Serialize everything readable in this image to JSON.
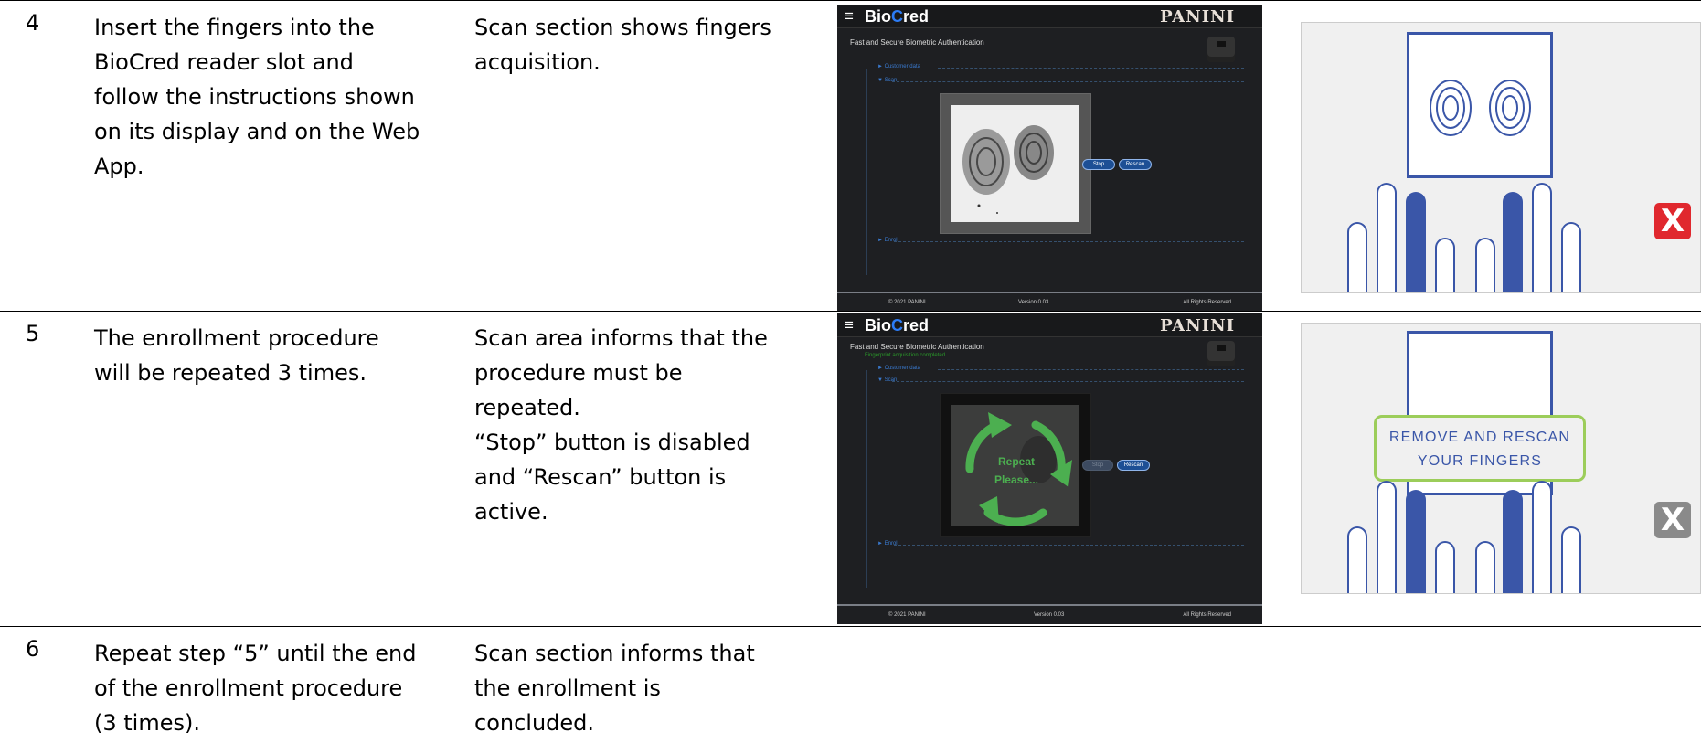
{
  "rows": [
    {
      "number": "4",
      "step_lines": [
        "Insert the fingers into the",
        "BioCred reader slot and",
        "follow the instructions shown",
        "on its display and on the Web",
        "App."
      ],
      "result_lines": [
        "Scan section shows fingers",
        "acquisition."
      ]
    },
    {
      "number": "5",
      "step_lines": [
        "The enrollment procedure",
        "will be repeated 3 times."
      ],
      "result_lines": [
        "Scan area informs that the",
        "procedure must be",
        "repeated.",
        "“Stop” button is disabled",
        "and “Rescan” button is",
        "active."
      ]
    },
    {
      "number": "6",
      "step_lines": [
        "Repeat step “5” until the end",
        "of the enrollment procedure",
        "(3 times)."
      ],
      "result_lines": [
        "Scan section informs that",
        "the enrollment is",
        "concluded."
      ]
    }
  ],
  "app": {
    "menu_icon": "≡",
    "brand_prefix": "Bio",
    "brand_c": "C",
    "brand_suffix": "red",
    "vendor": "PANINI",
    "subtitle": "Fast and Secure Biometric Authentication",
    "status_message": "Fingerprint acquisition completed",
    "sections": {
      "customer": "Customer data",
      "scan": "Scan",
      "enroll": "Enroll"
    },
    "stop_label": "Stop",
    "rescan_label": "Rescan",
    "repeat_line1": "Repeat",
    "repeat_line2": "Please...",
    "footer": {
      "copyright": "© 2021 PANINI",
      "version": "Version 0.03",
      "rights": "All Rights Reserved"
    }
  },
  "panel": {
    "msg_line1": "REMOVE AND RESCAN",
    "msg_line2": "YOUR FINGERS",
    "close_glyph": "X",
    "colors": {
      "blue": "#3a56a8",
      "red": "#e0282e",
      "green_border": "#9ccd5a",
      "grey": "#8a8a8a"
    }
  }
}
